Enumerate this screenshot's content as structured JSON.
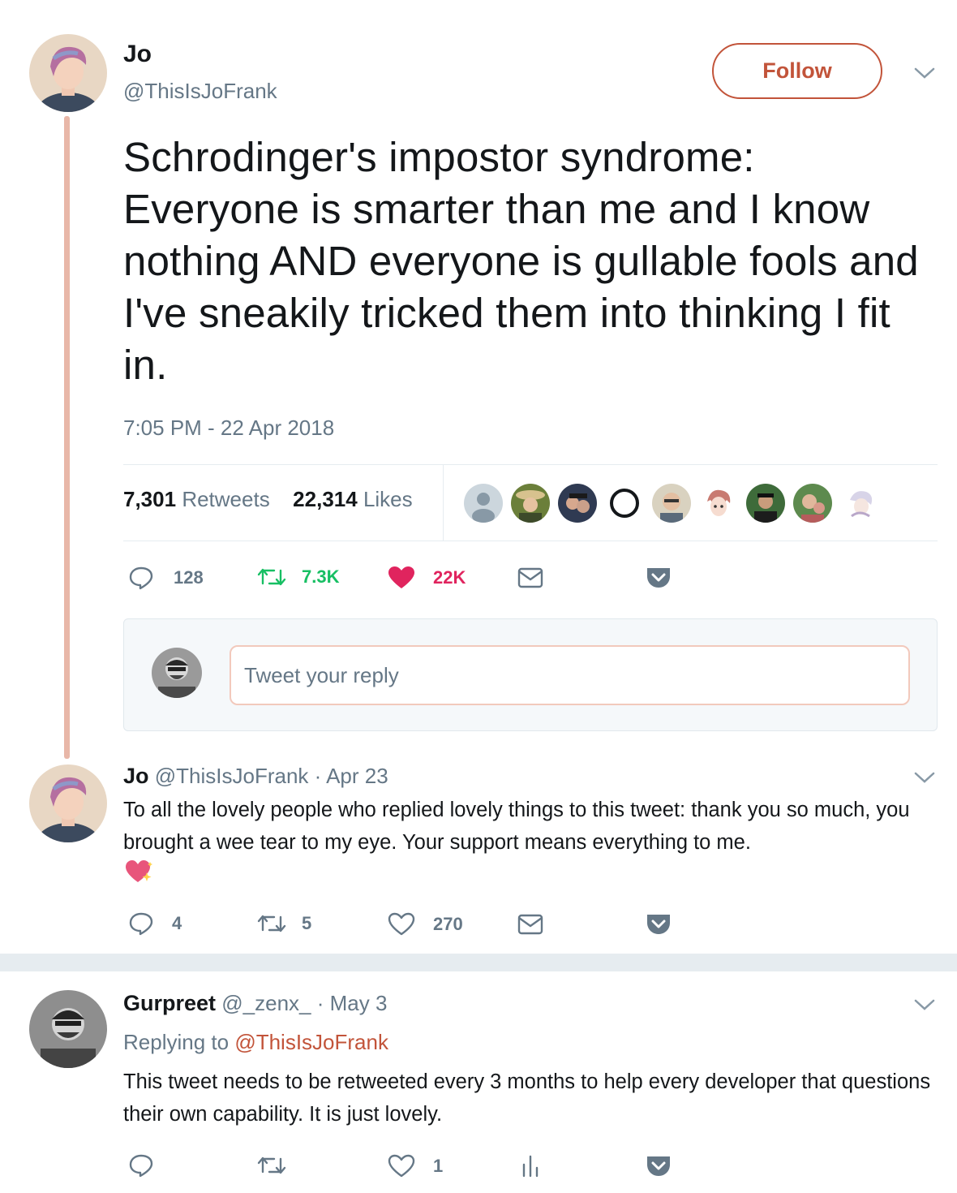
{
  "main_tweet": {
    "author_name": "Jo",
    "author_handle": "@ThisIsJoFrank",
    "follow_label": "Follow",
    "text": "Schrodinger's impostor syndrome: Everyone is smarter than me and I know nothing AND everyone is gullable fools and I've sneakily tricked them into thinking I fit in.",
    "timestamp": "7:05 PM - 22 Apr 2018",
    "retweets_count": "7,301",
    "retweets_label": "Retweets",
    "likes_count": "22,314",
    "likes_label": "Likes",
    "actions": {
      "replies": "128",
      "retweets": "7.3K",
      "likes": "22K"
    },
    "reply_placeholder": "Tweet your reply"
  },
  "thread_reply": {
    "author_name": "Jo",
    "author_handle": "@ThisIsJoFrank",
    "date": "· Apr 23",
    "text": "To all the lovely people who replied lovely things to this tweet: thank you so much, you brought a wee tear to my eye. Your support means everything to me.",
    "actions": {
      "replies": "4",
      "retweets": "5",
      "likes": "270"
    }
  },
  "reply": {
    "author_name": "Gurpreet",
    "author_handle": "@_zenx_",
    "date": "· May 3",
    "replying_to_label": "Replying to",
    "replying_to_handle": "@ThisIsJoFrank",
    "text": "This tweet needs to be retweeted every 3 months to help every developer that questions their own capability. It is just lovely.",
    "actions": {
      "likes": "1"
    }
  },
  "colors": {
    "accent": "#c2543a",
    "heart_red": "#e0245e",
    "retweet_green": "#17bf63",
    "muted": "#657786",
    "thread_line": "#e8b7a8"
  },
  "icons": [
    "reply-icon",
    "retweet-icon",
    "heart-icon",
    "message-icon",
    "pocket-icon",
    "chevron-down-icon",
    "analytics-icon",
    "sparkling-heart-emoji"
  ]
}
